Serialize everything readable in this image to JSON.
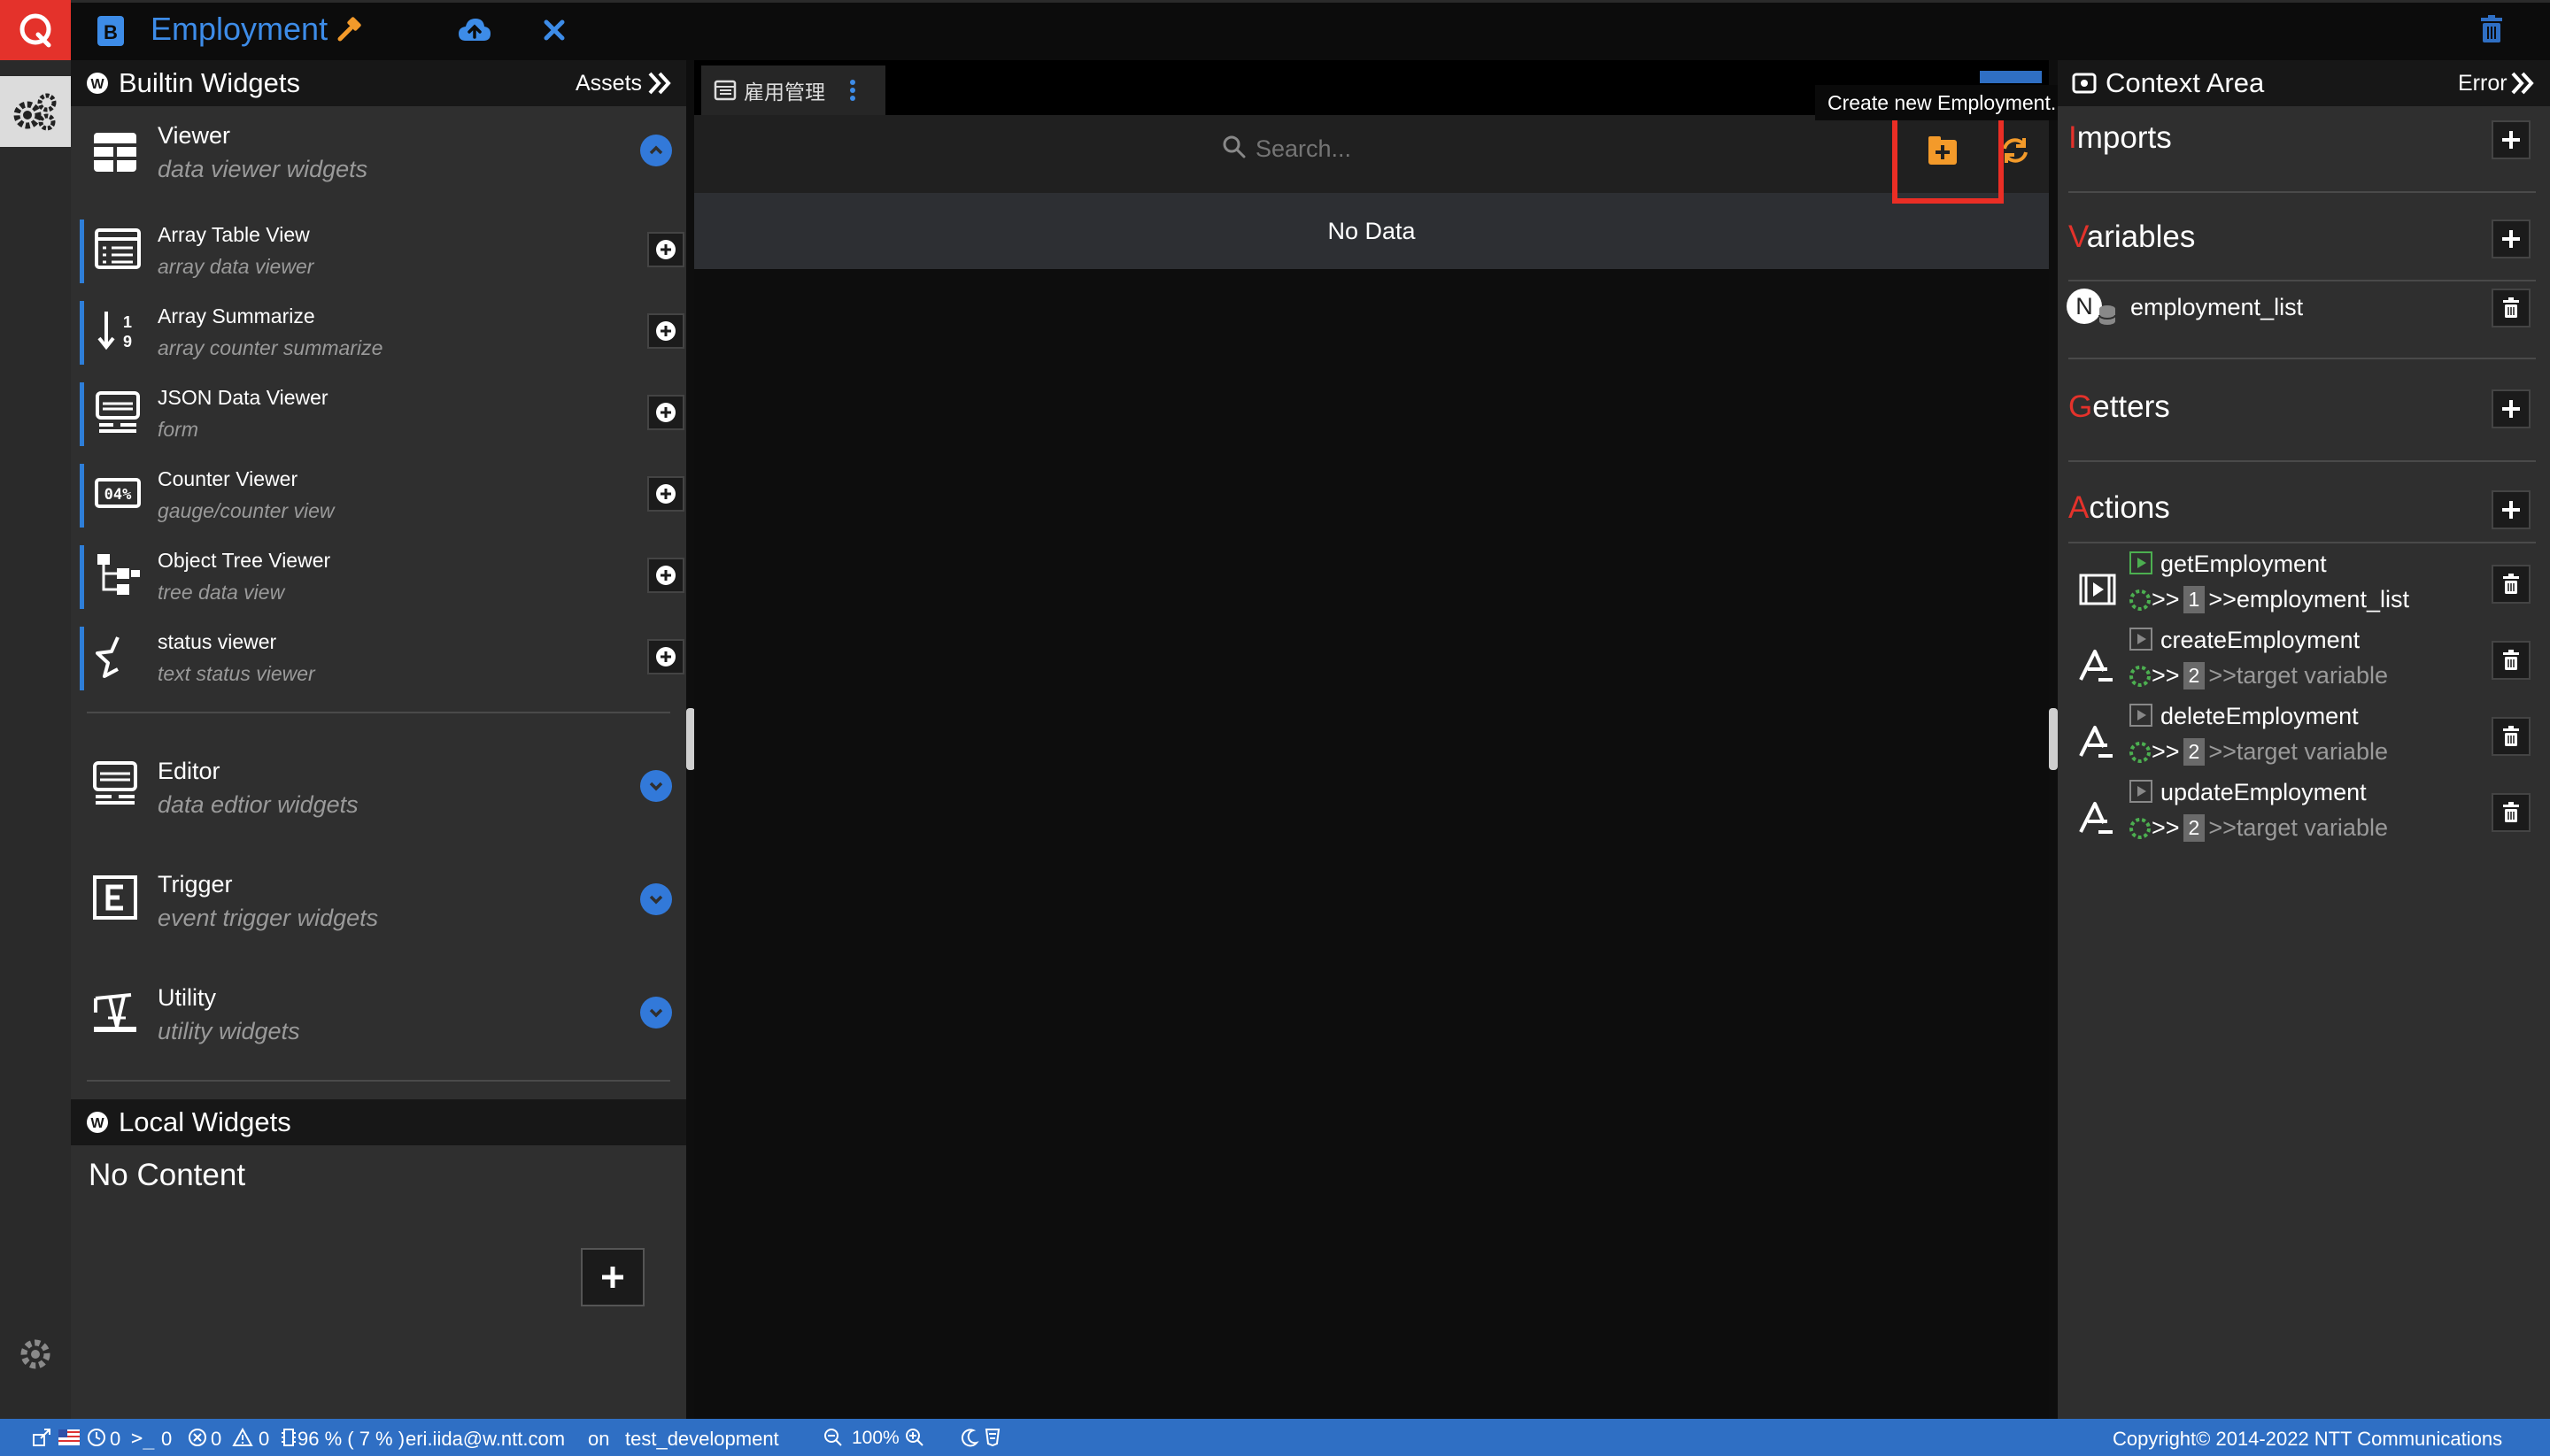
{
  "app": {
    "title": "Employment"
  },
  "left_panel": {
    "header_title": "Builtin Widgets",
    "assets_label": "Assets",
    "viewer": {
      "title": "Viewer",
      "subtitle": "data viewer widgets"
    },
    "widgets": [
      {
        "name": "Array Table View",
        "sub": "array data viewer"
      },
      {
        "name": "Array Summarize",
        "sub": "array counter summarize"
      },
      {
        "name": "JSON Data Viewer",
        "sub": "form"
      },
      {
        "name": "Counter Viewer",
        "sub": "gauge/counter view"
      },
      {
        "name": "Object Tree Viewer",
        "sub": "tree data view"
      },
      {
        "name": "status viewer",
        "sub": "text status viewer"
      }
    ],
    "editor": {
      "title": "Editor",
      "subtitle": "data edtior widgets"
    },
    "trigger": {
      "title": "Trigger",
      "subtitle": "event trigger widgets"
    },
    "utility": {
      "title": "Utility",
      "subtitle": "utility widgets"
    },
    "local_widgets_title": "Local Widgets",
    "no_content": "No Content"
  },
  "center": {
    "tab_label": "雇用管理",
    "search_placeholder": "Search...",
    "no_data": "No Data",
    "tooltip": "Create new Employment."
  },
  "right_panel": {
    "header_title": "Context Area",
    "error_label": "Error",
    "imports": {
      "first": "I",
      "rest": "mports"
    },
    "variables": {
      "first": "V",
      "rest": "ariables",
      "items": [
        {
          "badge": "N",
          "name": "employment_list"
        }
      ]
    },
    "getters": {
      "first": "G",
      "rest": "etters"
    },
    "actions": {
      "first": "A",
      "rest": "ctions",
      "items": [
        {
          "name": "getEmployment",
          "count": "1",
          "target": ">>employment_list"
        },
        {
          "name": "createEmployment",
          "count": "2",
          "target": ">>target variable"
        },
        {
          "name": "deleteEmployment",
          "count": "2",
          "target": ">>target variable"
        },
        {
          "name": "updateEmployment",
          "count": "2",
          "target": ">>target variable"
        }
      ]
    },
    "arrows": ">>"
  },
  "statusbar": {
    "clock_count": "0",
    "terminal_count": "0",
    "error_count": "0",
    "warning_count": "0",
    "memory": "96 % ( 7 % )",
    "user": "eri.iida@w.ntt.com",
    "on_label": "on",
    "environment": "test_development",
    "zoom": "100%",
    "copyright": "Copyright© 2014-2022 NTT Communications"
  },
  "colors": {
    "accent_blue": "#3d8ce8",
    "brand_red": "#e4322b",
    "highlight_red": "#ea2e25",
    "orange": "#f39a2a",
    "status_blue": "#2f6fc4"
  }
}
